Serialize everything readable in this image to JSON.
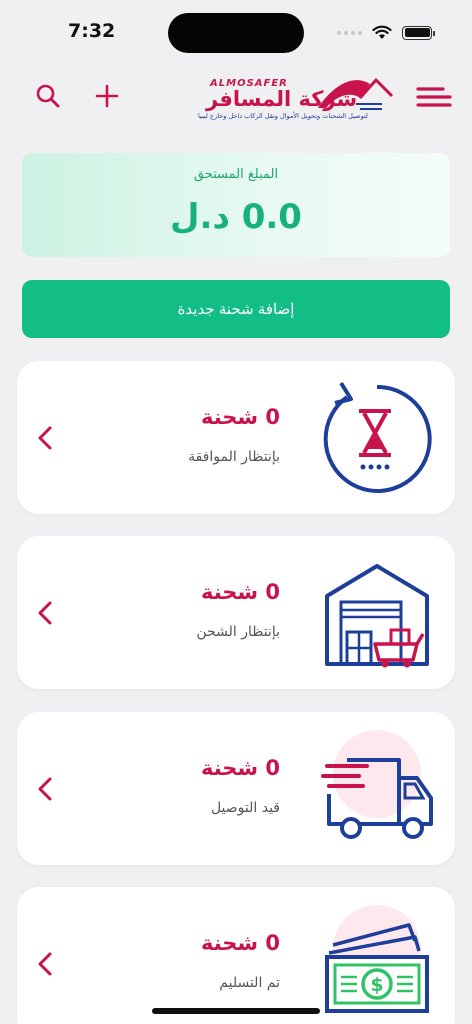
{
  "status_bar": {
    "time": "7:32"
  },
  "header": {
    "logo_latin": "ALMOSAFER",
    "logo_arabic": "شركة المسافر",
    "logo_tagline": "لتوصيل الشحنات وتحويل الأموال ونقل الركاب داخل وخارج ليبيا",
    "menu_icon": "menu-icon",
    "add_icon": "plus-icon",
    "search_icon": "search-icon"
  },
  "due": {
    "label": "المبلغ المستحق",
    "amount": "0.0 د.ل"
  },
  "add_shipment": {
    "label": "إضافة شحنة جديدة"
  },
  "cards": [
    {
      "count": "0 شحنة",
      "label": "بإنتظار الموافقة",
      "icon": "hourglass-refresh-icon"
    },
    {
      "count": "0 شحنة",
      "label": "بإنتظار الشحن",
      "icon": "warehouse-icon"
    },
    {
      "count": "0 شحنة",
      "label": "قيد التوصيل",
      "icon": "delivery-truck-icon"
    },
    {
      "count": "0 شحنة",
      "label": "تم التسليم",
      "icon": "money-icon"
    }
  ],
  "colors": {
    "brand": "#c8134c",
    "accent_green": "#12bd86",
    "navy": "#1e3f99"
  }
}
